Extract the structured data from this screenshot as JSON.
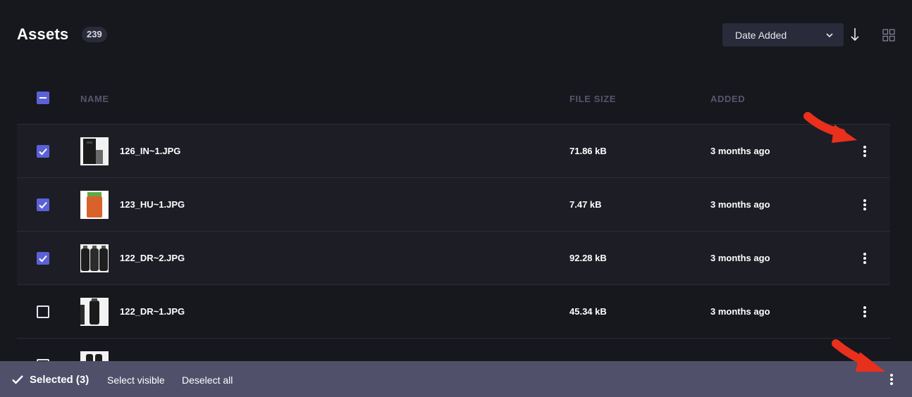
{
  "header": {
    "title": "Assets",
    "count": "239",
    "sort": {
      "selected": "Date Added",
      "direction_icon": "arrow-down-icon"
    },
    "view_icon": "grid-icon"
  },
  "table": {
    "columns": {
      "name": "NAME",
      "file_size": "FILE SIZE",
      "added": "ADDED"
    },
    "rows": [
      {
        "name": "126_IN~1.JPG",
        "size": "71.86 kB",
        "added": "3 months ago",
        "checked": true
      },
      {
        "name": "123_HU~1.JPG",
        "size": "7.47 kB",
        "added": "3 months ago",
        "checked": true
      },
      {
        "name": "122_DR~2.JPG",
        "size": "92.28 kB",
        "added": "3 months ago",
        "checked": true
      },
      {
        "name": "122_DR~1.JPG",
        "size": "45.34 kB",
        "added": "3 months ago",
        "checked": false
      }
    ]
  },
  "selection_bar": {
    "label": "Selected (3)",
    "select_visible": "Select visible",
    "deselect_all": "Deselect all"
  },
  "colors": {
    "background": "#17171e",
    "accent": "#5b61d6",
    "selection_bar": "#50506b",
    "annotation_arrow": "#e8301c"
  }
}
